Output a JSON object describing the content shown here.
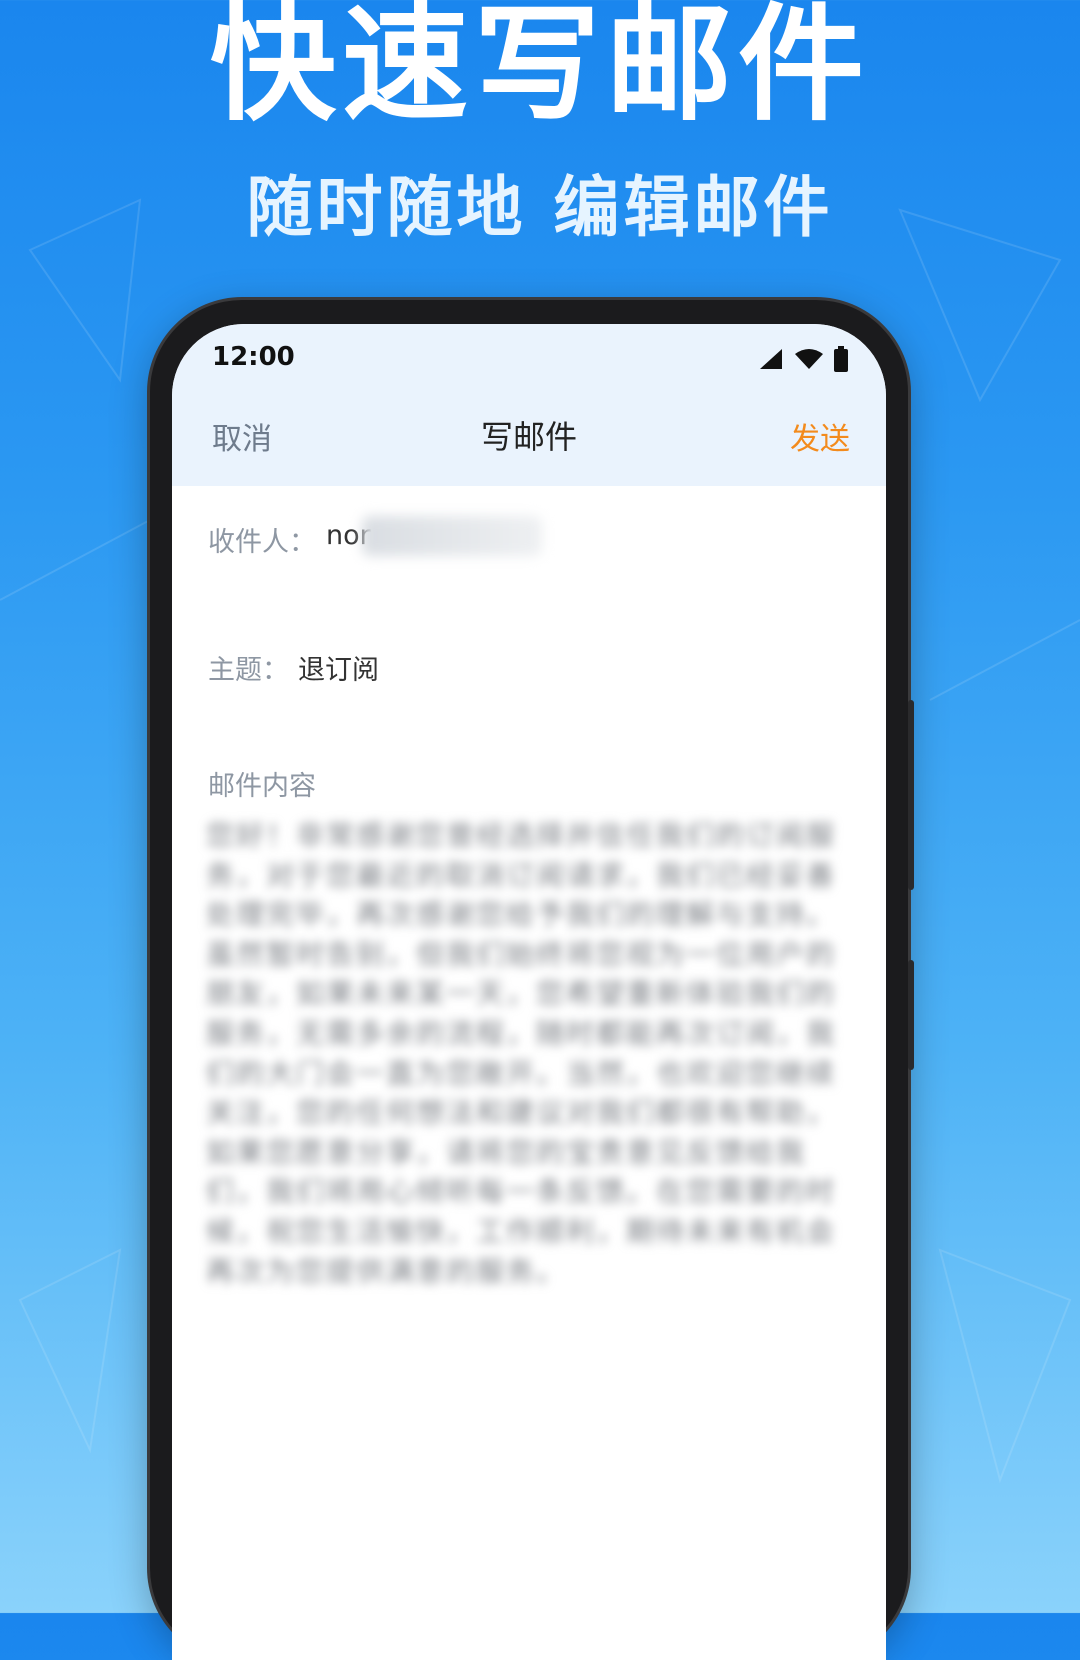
{
  "promo": {
    "headline": "快速写邮件",
    "subline": "随时随地 编辑邮件"
  },
  "status_bar": {
    "time": "12:00",
    "icons": [
      "signal-icon",
      "wifi-icon",
      "battery-icon"
    ]
  },
  "nav": {
    "cancel_label": "取消",
    "title": "写邮件",
    "send_label": "发送"
  },
  "compose": {
    "recipient_label": "收件人：",
    "recipient_value": "nor",
    "subject_label": "主题：",
    "subject_value": "退订阅",
    "body_placeholder": "邮件内容",
    "body_text": "您好！非常感谢您曾经选择并信任我们的订阅服务，对于您最近的取消订阅请求，我们已经妥善处理完毕，再次感谢您给予我们的理解与支持。虽然暂时告别，但我们始终将您视为一位用户的朋友，如果未来某一天，您希望重新体验我们的服务，无需多余的流程，随时都能再次订阅，我们的大门会一直为您敞开。当然，也欢迎您继续关注，您的任何想法和建议对我们都很有帮助，如果您愿意分享，请将您的宝贵意见反馈给我们，我们将用心倾听每一条反馈。在您需要的时候，祝您生活愉快，工作顺利，期待未来有机会再次为您提供满意的服务。"
  },
  "colors": {
    "background_top": "#1a86ee",
    "background_bottom": "#8ad2fb",
    "send_accent": "#f38b1d",
    "header_bg": "#eaf3fd"
  }
}
